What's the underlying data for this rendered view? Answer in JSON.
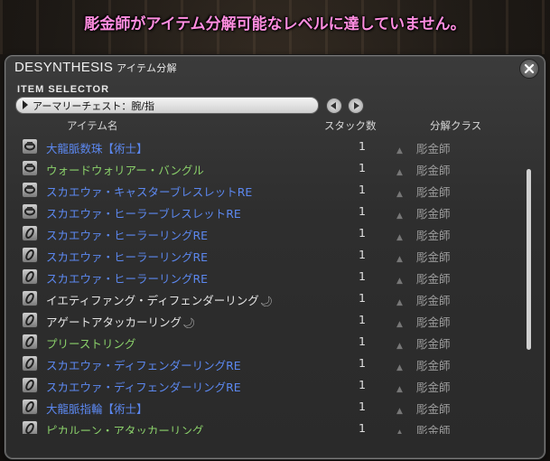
{
  "notice": "彫金師がアイテム分解可能なレベルに達していません。",
  "window": {
    "title": "DESYNTHESIS",
    "subtitle": "アイテム分解",
    "selector_label": "ITEM SELECTOR",
    "dropdown_value": "アーマリーチェスト：腕/指",
    "columns": {
      "name": "アイテム名",
      "stack": "スタック数",
      "class": "分解クラス"
    }
  },
  "colors": {
    "blue": "#5c88f0",
    "green": "#8ad06a",
    "white": "#e4e4e4",
    "notice": "#ff8de0"
  },
  "items": [
    {
      "name": "大龍脈数珠【術士】",
      "color": "blue",
      "icon": "bracelet-icon",
      "hq": false,
      "stack": "1",
      "class": "彫金師"
    },
    {
      "name": "ウォードウォリアー・バングル",
      "color": "green",
      "icon": "bracelet-icon",
      "hq": false,
      "stack": "1",
      "class": "彫金師"
    },
    {
      "name": "スカエウァ・キャスターブレスレットRE",
      "color": "blue",
      "icon": "bracelet-icon",
      "hq": false,
      "stack": "1",
      "class": "彫金師"
    },
    {
      "name": "スカエウァ・ヒーラーブレスレットRE",
      "color": "blue",
      "icon": "bracelet-icon",
      "hq": false,
      "stack": "1",
      "class": "彫金師"
    },
    {
      "name": "スカエウァ・ヒーラーリングRE",
      "color": "blue",
      "icon": "ring-icon",
      "hq": false,
      "stack": "1",
      "class": "彫金師"
    },
    {
      "name": "スカエウァ・ヒーラーリングRE",
      "color": "blue",
      "icon": "ring-icon",
      "hq": false,
      "stack": "1",
      "class": "彫金師"
    },
    {
      "name": "スカエウァ・ヒーラーリングRE",
      "color": "blue",
      "icon": "ring-icon",
      "hq": false,
      "stack": "1",
      "class": "彫金師"
    },
    {
      "name": "イエティファング・ディフェンダーリング",
      "color": "white",
      "icon": "ring-icon",
      "hq": true,
      "stack": "1",
      "class": "彫金師"
    },
    {
      "name": "アゲートアタッカーリング",
      "color": "white",
      "icon": "ring-icon",
      "hq": true,
      "stack": "1",
      "class": "彫金師"
    },
    {
      "name": "プリーストリング",
      "color": "green",
      "icon": "ring-icon",
      "hq": false,
      "stack": "1",
      "class": "彫金師"
    },
    {
      "name": "スカエウァ・ディフェンダーリングRE",
      "color": "blue",
      "icon": "ring-icon",
      "hq": false,
      "stack": "1",
      "class": "彫金師"
    },
    {
      "name": "スカエウァ・ディフェンダーリングRE",
      "color": "blue",
      "icon": "ring-icon",
      "hq": false,
      "stack": "1",
      "class": "彫金師"
    },
    {
      "name": "大龍脈指輪【術士】",
      "color": "blue",
      "icon": "ring-icon",
      "hq": false,
      "stack": "1",
      "class": "彫金師"
    },
    {
      "name": "ピカルーン・アタッカーリング",
      "color": "green",
      "icon": "ring-icon",
      "hq": false,
      "stack": "1",
      "class": "彫金師"
    }
  ]
}
